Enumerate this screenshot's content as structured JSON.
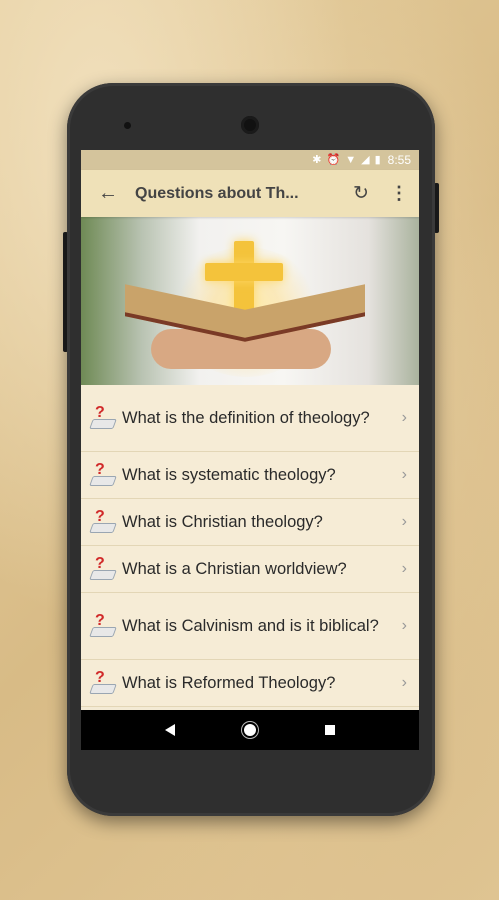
{
  "status_bar": {
    "icons": [
      "bluetooth-icon",
      "alarm-icon",
      "wifi-icon",
      "signal-icon",
      "battery-icon"
    ],
    "time": "8:55"
  },
  "app_bar": {
    "back_icon": "arrow-back-icon",
    "title": "Questions about Th...",
    "refresh_icon": "refresh-icon",
    "more_icon": "more-vert-icon"
  },
  "hero_image": {
    "description_icon": "cross-bible-image"
  },
  "questions": [
    {
      "label": "What is the definition of theology?"
    },
    {
      "label": "What is systematic theology?"
    },
    {
      "label": "What is Christian theology?"
    },
    {
      "label": "What is a Christian worldview?"
    },
    {
      "label": "What is Calvinism and is it biblical?"
    },
    {
      "label": "What is Reformed Theology?"
    }
  ],
  "colors": {
    "status_bar": "#d4c49c",
    "app_bar": "#efe1b8",
    "list_bg": "#f6ecd6",
    "nav_bar": "#000000"
  },
  "nav_bar": {
    "back": "nav-back-icon",
    "home": "nav-home-icon",
    "recents": "nav-recents-icon"
  }
}
